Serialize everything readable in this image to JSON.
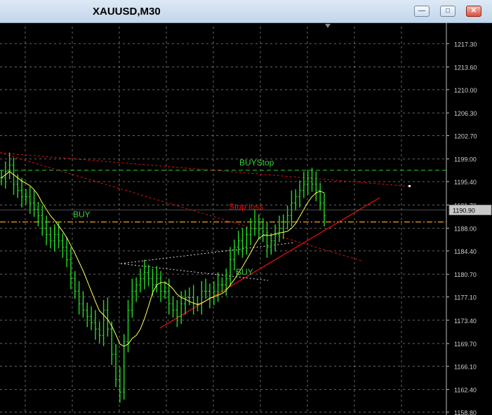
{
  "window": {
    "title": "XAUUSD,M30",
    "buttons": {
      "minimize_icon": "minimize-icon",
      "maximize_icon": "maximize-icon",
      "close_icon": "close-icon"
    }
  },
  "colors": {
    "background": "#000000",
    "grid": "#8a8a8a",
    "bars": "#22dd22",
    "moving_average": "#ffff55",
    "trendline_red": "#e01010",
    "buystop_line": "#22aa22",
    "buy_level_line": "#e8a020",
    "label_buy": "#3ad13a",
    "label_buystop": "#3ad13a",
    "label_stoploss": "#e01010",
    "price_box": "#c8c8c8"
  },
  "chart_data": {
    "type": "candlestick",
    "symbol": "XAUUSD",
    "timeframe": "M30",
    "ylim": [
      1158.8,
      1220.0
    ],
    "price_axis_ticks": [
      "1217.30",
      "1213.60",
      "1210.00",
      "1206.30",
      "1202.70",
      "1199.00",
      "1195.40",
      "1191.70",
      "1188.00",
      "1184.40",
      "1180.70",
      "1177.10",
      "1173.40",
      "1169.70",
      "1166.10",
      "1162.40",
      "1158.80"
    ],
    "current_price": "1190.90",
    "levels": [
      {
        "name": "BUYStop",
        "price": 1197.2,
        "style": "dashed",
        "color": "#22aa22"
      },
      {
        "name": "BUY",
        "price": 1189.0,
        "style": "dash-dot",
        "color": "#e8a020"
      }
    ],
    "annotations": [
      {
        "text": "BUYStop",
        "color": "#3ad13a"
      },
      {
        "text": "BUY",
        "color": "#3ad13a"
      },
      {
        "text": "Stop loss",
        "color": "#e01010"
      },
      {
        "text": "BUY",
        "color": "#3ad13a"
      }
    ],
    "close_series": [
      1196,
      1197,
      1198,
      1195,
      1194,
      1193,
      1193,
      1192,
      1191,
      1190,
      1188,
      1187,
      1186,
      1187,
      1186,
      1185,
      1183,
      1180,
      1178,
      1176,
      1175,
      1174,
      1173,
      1172,
      1171,
      1175,
      1172,
      1168,
      1164,
      1162,
      1170,
      1175,
      1178,
      1179,
      1180,
      1181,
      1180,
      1179,
      1180,
      1178,
      1178,
      1176,
      1175,
      1174,
      1176,
      1177,
      1177,
      1176,
      1176,
      1178,
      1178,
      1177,
      1178,
      1179,
      1179,
      1180,
      1183,
      1185,
      1186,
      1185,
      1187,
      1188,
      1189,
      1188,
      1187,
      1185,
      1186,
      1187,
      1188,
      1189,
      1190,
      1192,
      1193,
      1194,
      1195,
      1196,
      1195,
      1194,
      1192,
      1190
    ],
    "grid": true
  }
}
